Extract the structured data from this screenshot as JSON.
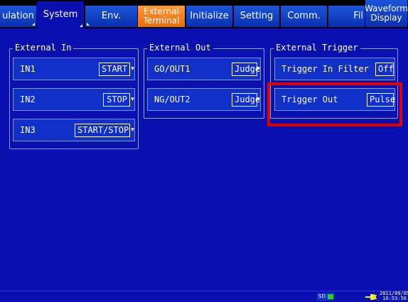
{
  "tabs": {
    "calculation": "ulation",
    "system": "System",
    "env": "Env.",
    "external_terminal_line1": "External",
    "external_terminal_line2": "Terminal",
    "initialize": "Initialize",
    "setting": "Setting",
    "comm": "Comm.",
    "file": "Fil",
    "waveform_line1": "Waveform",
    "waveform_line2": "Display"
  },
  "external_in": {
    "title": "External In",
    "rows": [
      {
        "label": "IN1",
        "value": "START"
      },
      {
        "label": "IN2",
        "value": "STOP"
      },
      {
        "label": "IN3",
        "value": "START/STOP"
      }
    ]
  },
  "external_out": {
    "title": "External Out",
    "rows": [
      {
        "label": "GO/OUT1",
        "value": "Judge"
      },
      {
        "label": "NG/OUT2",
        "value": "Judge"
      }
    ]
  },
  "external_trigger": {
    "title": "External Trigger",
    "rows": [
      {
        "label": "Trigger In Filter",
        "value": "Off"
      },
      {
        "label": "Trigger Out",
        "value": "Pulse"
      }
    ]
  },
  "status": {
    "sd_label": "SD",
    "date": "2011/09/05",
    "time": "16:53:56"
  },
  "colors": {
    "background": "#0a0fb0",
    "selected_tab": "#f07a10",
    "highlight": "#e10000"
  }
}
